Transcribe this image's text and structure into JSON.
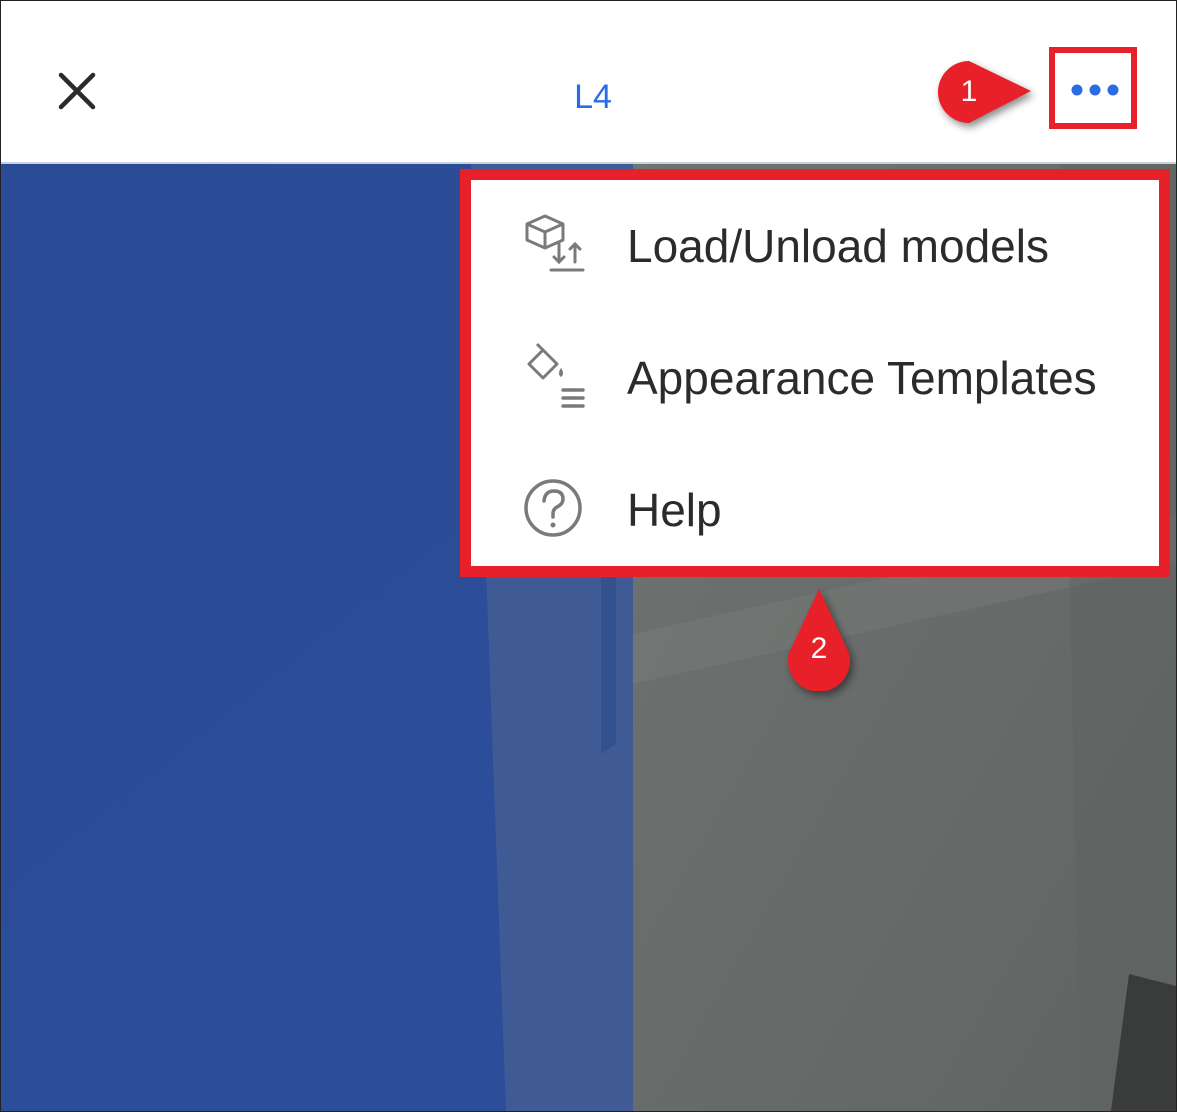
{
  "header": {
    "title": "L4",
    "close_icon": "close-icon",
    "more_icon": "more-horizontal-icon",
    "accent_color": "#2a6ce8"
  },
  "menu": {
    "items": [
      {
        "label": "Load/Unload models",
        "icon": "box-upload-download-icon"
      },
      {
        "label": "Appearance Templates",
        "icon": "paint-bucket-list-icon"
      },
      {
        "label": "Help",
        "icon": "help-circle-icon"
      }
    ]
  },
  "callouts": [
    {
      "number": "1"
    },
    {
      "number": "2"
    }
  ],
  "colors": {
    "highlight": "#e8202a",
    "viewport_blue": "#2b4c98",
    "viewport_gray": "#6a6e6c"
  }
}
